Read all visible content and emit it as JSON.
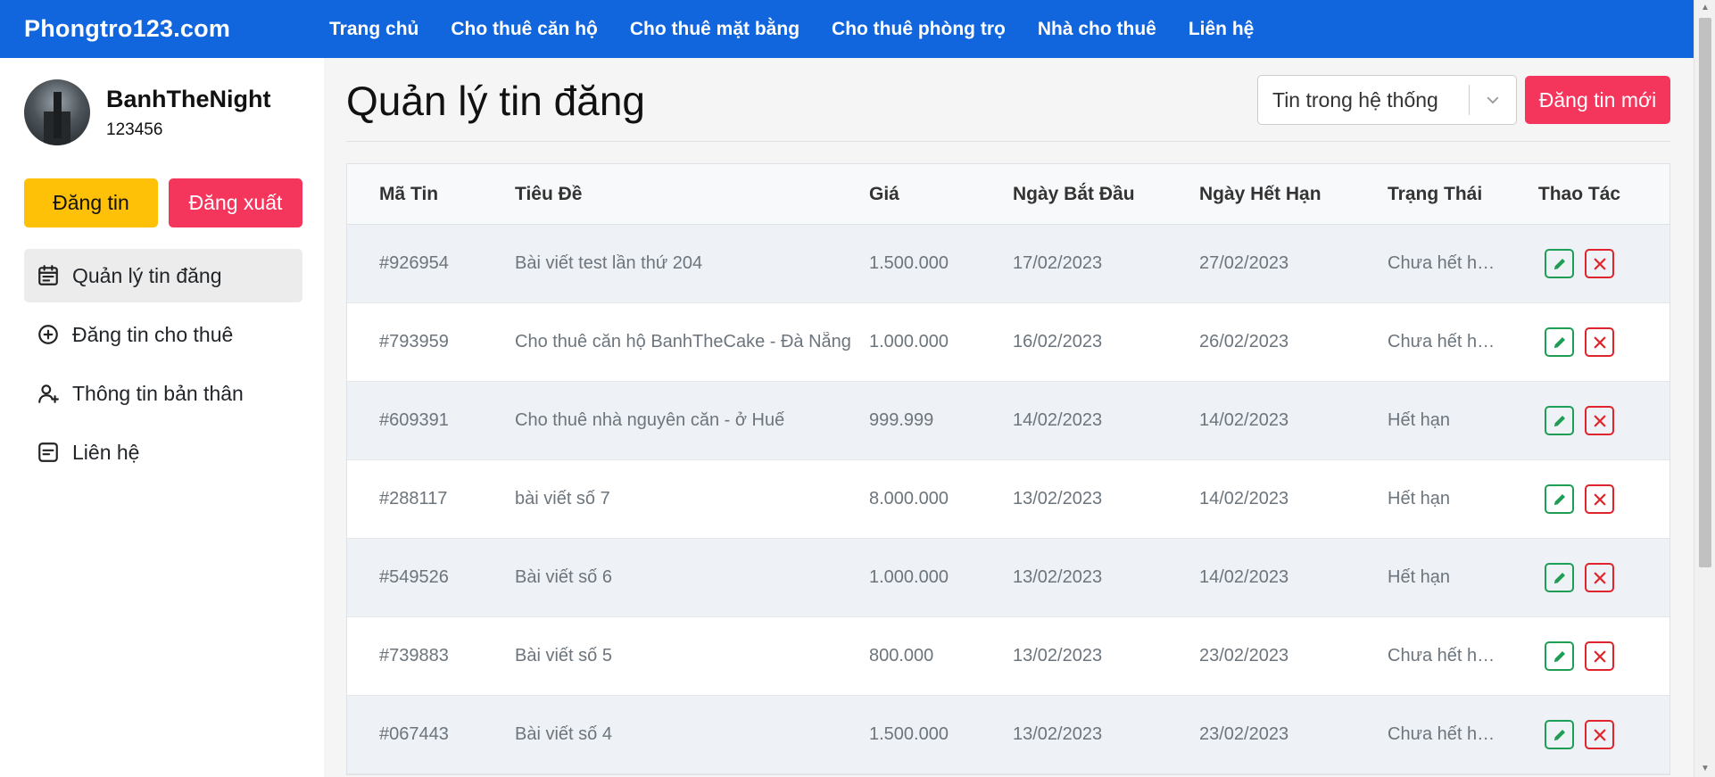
{
  "nav": {
    "brand": "Phongtro123.com",
    "links": [
      "Trang chủ",
      "Cho thuê căn hộ",
      "Cho thuê mặt bằng",
      "Cho thuê phòng trọ",
      "Nhà cho thuê",
      "Liên hệ"
    ]
  },
  "sidebar": {
    "username": "BanhTheNight",
    "phone": "123456",
    "post_button": "Đăng tin",
    "logout_button": "Đăng xuất",
    "menu": [
      {
        "label": "Quản lý tin đăng",
        "icon": "calendar-icon"
      },
      {
        "label": "Đăng tin cho thuê",
        "icon": "plus-circle-icon"
      },
      {
        "label": "Thông tin bản thân",
        "icon": "user-plus-icon"
      },
      {
        "label": "Liên hệ",
        "icon": "message-icon"
      }
    ]
  },
  "main": {
    "title": "Quản lý tin đăng",
    "filter_value": "Tin trong hệ thống",
    "new_post_button": "Đăng tin mới"
  },
  "table": {
    "headers": [
      "Mã Tin",
      "Tiêu Đề",
      "Giá",
      "Ngày Bắt Đầu",
      "Ngày Hết Hạn",
      "Trạng Thái",
      "Thao Tác"
    ],
    "rows": [
      {
        "id": "#926954",
        "title": "Bài viết test lần thứ 204",
        "price": "1.500.000",
        "start": "17/02/2023",
        "end": "27/02/2023",
        "status": "Chưa hết hạn"
      },
      {
        "id": "#793959",
        "title": "Cho thuê căn hộ BanhTheCake - Đà Nẵng",
        "price": "1.000.000",
        "start": "16/02/2023",
        "end": "26/02/2023",
        "status": "Chưa hết hạn"
      },
      {
        "id": "#609391",
        "title": "Cho thuê nhà nguyên căn - ở Huế",
        "price": "999.999",
        "start": "14/02/2023",
        "end": "14/02/2023",
        "status": "Hết hạn"
      },
      {
        "id": "#288117",
        "title": "bài viết số 7",
        "price": "8.000.000",
        "start": "13/02/2023",
        "end": "14/02/2023",
        "status": "Hết hạn"
      },
      {
        "id": "#549526",
        "title": "Bài viết số 6",
        "price": "1.000.000",
        "start": "13/02/2023",
        "end": "14/02/2023",
        "status": "Hết hạn"
      },
      {
        "id": "#739883",
        "title": "Bài viết số 5",
        "price": "800.000",
        "start": "13/02/2023",
        "end": "23/02/2023",
        "status": "Chưa hết hạn"
      },
      {
        "id": "#067443",
        "title": "Bài viết số 4",
        "price": "1.500.000",
        "start": "13/02/2023",
        "end": "23/02/2023",
        "status": "Chưa hết hạn"
      }
    ]
  },
  "colors": {
    "nav_bg": "#1266dd",
    "yellow": "#ffc107",
    "red": "#f5365c",
    "edit_green": "#1f9d55",
    "delete_red": "#e0242c"
  }
}
